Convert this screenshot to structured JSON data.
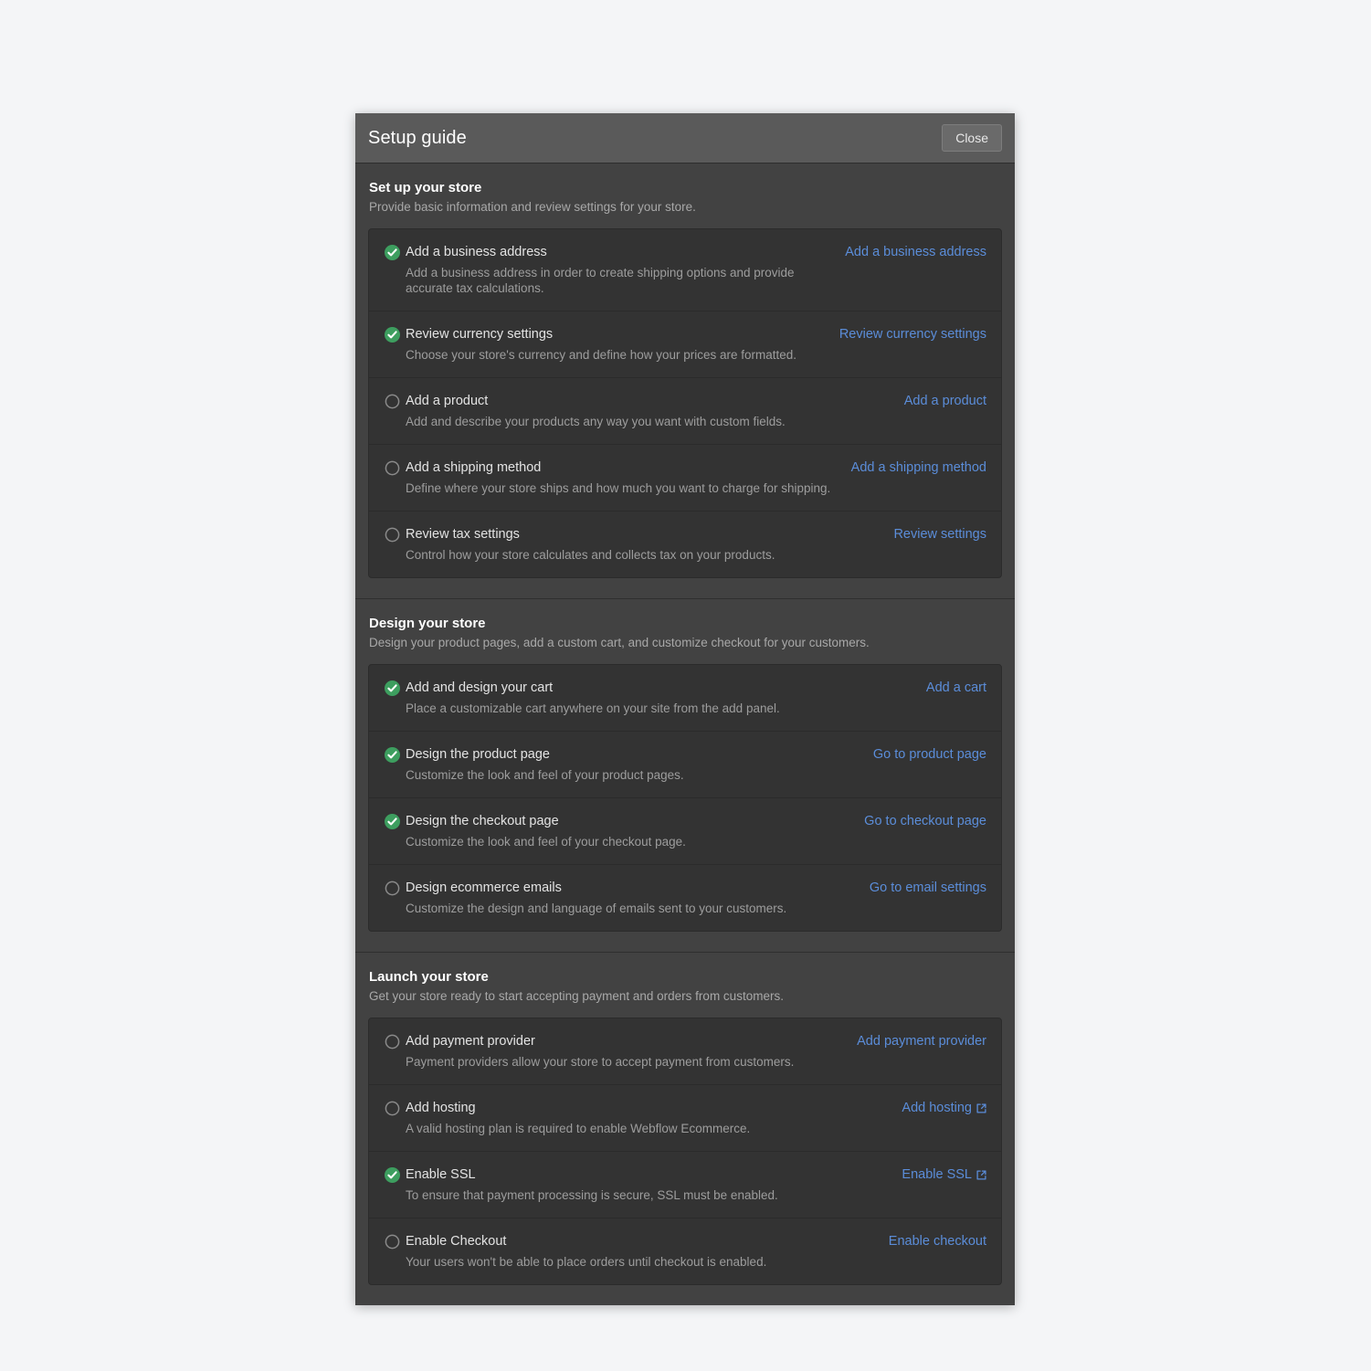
{
  "modal": {
    "title": "Setup guide",
    "close_label": "Close"
  },
  "colors": {
    "link": "#5b8dd9",
    "check_green": "#3d9e5f",
    "circle_gray": "#8a8a8a",
    "page_bg": "#f4f5f7",
    "modal_bg": "#3d3d3d",
    "section_bg": "#424242",
    "card_bg": "#333333",
    "header_bg": "#5a5a5a"
  },
  "sections": [
    {
      "title": "Set up your store",
      "subtitle": "Provide basic information and review settings for your store.",
      "items": [
        {
          "status": "complete",
          "status_icon": "check-circle-icon",
          "title": "Add a business address",
          "description": "Add a business address in order to create shipping options and provide accurate tax calculations.",
          "action_label": "Add a business address",
          "external": false
        },
        {
          "status": "complete",
          "status_icon": "check-circle-icon",
          "title": "Review currency settings",
          "description": "Choose your store's currency and define how your prices are formatted.",
          "action_label": "Review currency settings",
          "external": false
        },
        {
          "status": "incomplete",
          "status_icon": "empty-circle-icon",
          "title": "Add a product",
          "description": "Add and describe your products any way you want with custom fields.",
          "action_label": "Add a product",
          "external": false
        },
        {
          "status": "incomplete",
          "status_icon": "empty-circle-icon",
          "title": "Add a shipping method",
          "description": "Define where your store ships and how much you want to charge for shipping.",
          "action_label": "Add a shipping method",
          "external": false
        },
        {
          "status": "incomplete",
          "status_icon": "empty-circle-icon",
          "title": "Review tax settings",
          "description": "Control how your store calculates and collects tax on your products.",
          "action_label": "Review settings",
          "external": false
        }
      ]
    },
    {
      "title": "Design your store",
      "subtitle": "Design your product pages, add a custom cart, and customize checkout for your customers.",
      "items": [
        {
          "status": "complete",
          "status_icon": "check-circle-icon",
          "title": "Add and design your cart",
          "description": "Place a customizable cart anywhere on your site from the add panel.",
          "action_label": "Add a cart",
          "external": false
        },
        {
          "status": "complete",
          "status_icon": "check-circle-icon",
          "title": "Design the product page",
          "description": "Customize the look and feel of your product pages.",
          "action_label": "Go to product page",
          "external": false
        },
        {
          "status": "complete",
          "status_icon": "check-circle-icon",
          "title": "Design the checkout page",
          "description": "Customize the look and feel of your checkout page.",
          "action_label": "Go to checkout page",
          "external": false
        },
        {
          "status": "incomplete",
          "status_icon": "empty-circle-icon",
          "title": "Design ecommerce emails",
          "description": "Customize the design and language of emails sent to your customers.",
          "action_label": "Go to email settings",
          "external": false
        }
      ]
    },
    {
      "title": "Launch your store",
      "subtitle": "Get your store ready to start accepting payment and orders from customers.",
      "items": [
        {
          "status": "incomplete",
          "status_icon": "empty-circle-icon",
          "title": "Add payment provider",
          "description": "Payment providers allow your store to accept payment from customers.",
          "action_label": "Add payment provider",
          "external": false
        },
        {
          "status": "incomplete",
          "status_icon": "empty-circle-icon",
          "title": "Add hosting",
          "description": "A valid hosting plan is required to enable Webflow Ecommerce.",
          "action_label": "Add hosting",
          "external": true
        },
        {
          "status": "complete",
          "status_icon": "check-circle-icon",
          "title": "Enable SSL",
          "description": "To ensure that payment processing is secure, SSL must be enabled.",
          "action_label": "Enable SSL",
          "external": true
        },
        {
          "status": "incomplete",
          "status_icon": "empty-circle-icon",
          "title": "Enable Checkout",
          "description": "Your users won't be able to place orders until checkout is enabled.",
          "action_label": "Enable checkout",
          "external": false
        }
      ]
    }
  ]
}
